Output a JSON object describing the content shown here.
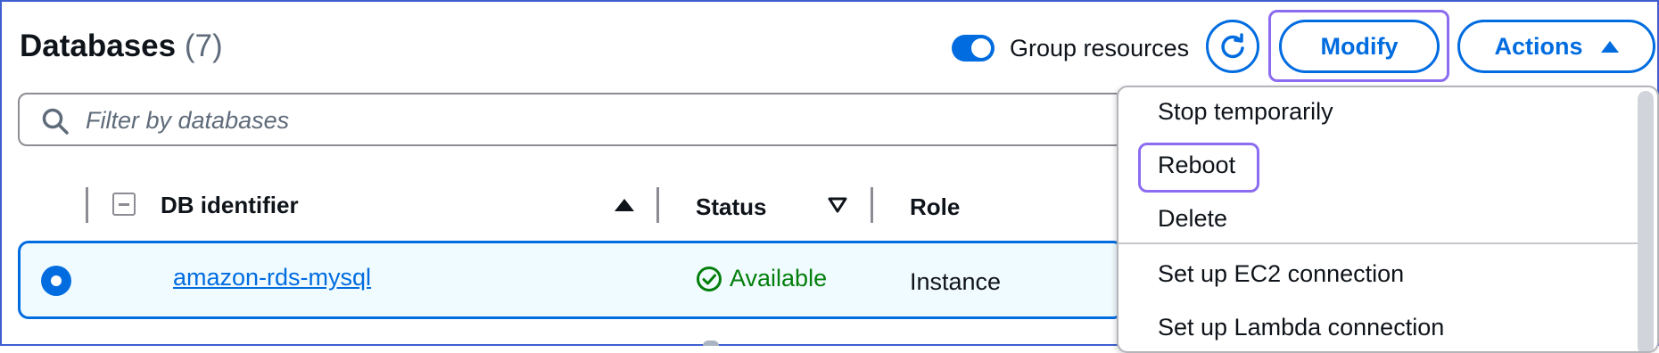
{
  "header": {
    "title": "Databases",
    "count": "(7)",
    "toggle_label": "Group resources",
    "toggle_on": true,
    "modify_label": "Modify",
    "actions_label": "Actions"
  },
  "search": {
    "placeholder": "Filter by databases"
  },
  "table": {
    "columns": [
      "DB identifier",
      "Status",
      "Role"
    ],
    "rows": [
      {
        "id": "amazon-rds-mysql",
        "status": "Available",
        "role": "Instance",
        "selected": true
      }
    ]
  },
  "actions_menu": {
    "items": [
      "Stop temporarily",
      "Reboot",
      "Delete",
      "Set up EC2 connection",
      "Set up Lambda connection"
    ]
  },
  "colors": {
    "accent": "#006ce0",
    "success": "#037f0c",
    "highlight": "#8c6cf0",
    "text": "#0f141a",
    "muted": "#5f6b7a"
  }
}
